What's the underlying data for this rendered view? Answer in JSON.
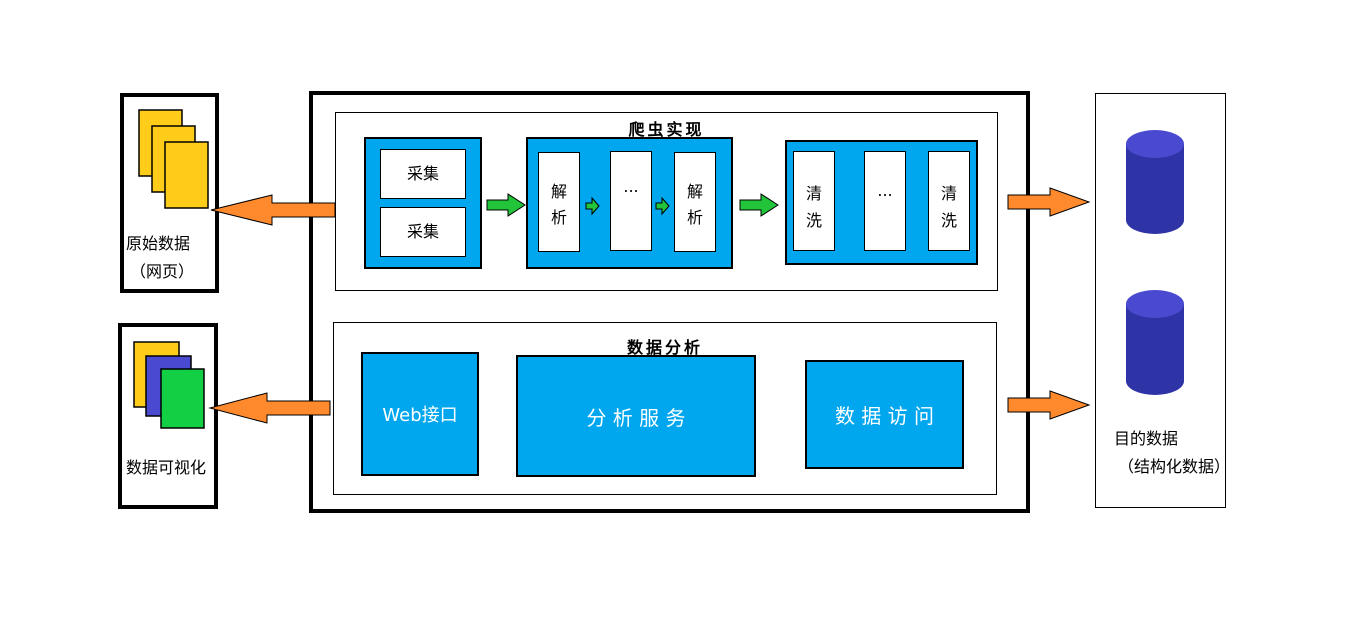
{
  "left_top": {
    "label_line1": "原始数据",
    "label_line2": "（网页）"
  },
  "left_bottom": {
    "label": "数据可视化"
  },
  "crawler": {
    "title": "爬虫实现",
    "collect": [
      "采集",
      "采集"
    ],
    "parse": [
      {
        "line1": "解",
        "line2": "析"
      },
      {
        "ellipsis": "..."
      },
      {
        "line1": "解",
        "line2": "析"
      }
    ],
    "clean": [
      {
        "line1": "清",
        "line2": "洗"
      },
      {
        "ellipsis": "..."
      },
      {
        "line1": "清",
        "line2": "洗"
      }
    ]
  },
  "analysis": {
    "title": "数据分析",
    "web_api": "Web接口",
    "service": "分 析 服 务",
    "access": "数 据 访 问"
  },
  "right": {
    "label_line1": "目的数据",
    "label_line2": "（结构化数据）"
  },
  "colors": {
    "blue": "#00a6ee",
    "orange_arrow": "#ff8a2e",
    "green_arrow": "#22c43a",
    "cylinder": "#2e33a6",
    "doc_yellow": "#ffcc1a",
    "doc_purple": "#4a4ad0",
    "doc_green": "#12cf44"
  }
}
